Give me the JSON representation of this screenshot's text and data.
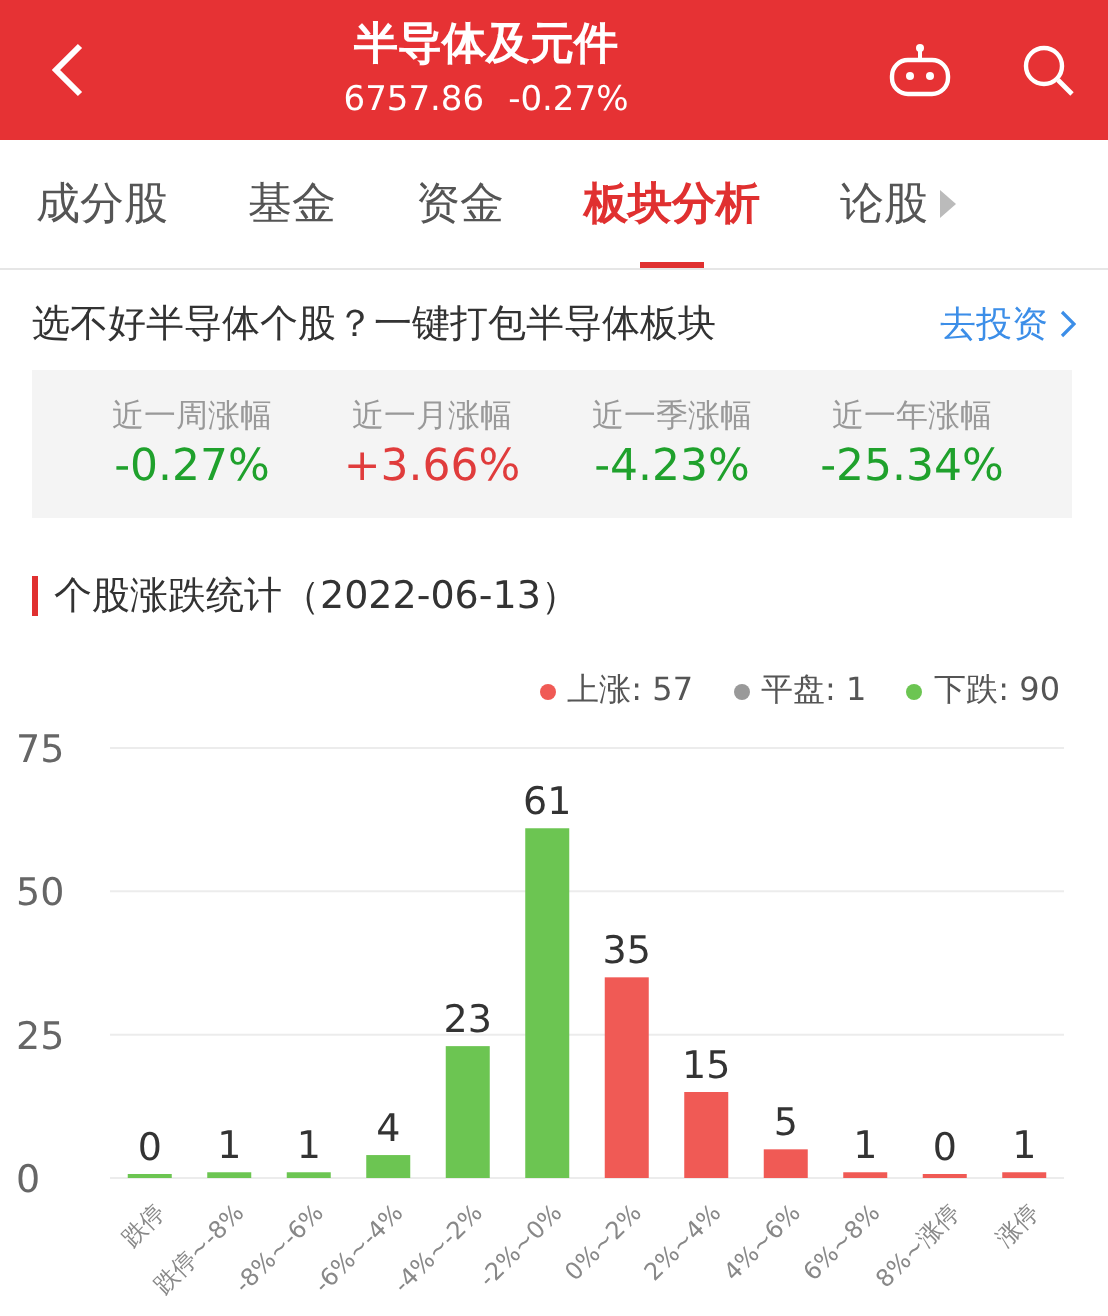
{
  "header": {
    "title": "半导体及元件",
    "price": "6757.86",
    "change": "-0.27%"
  },
  "tabs": [
    {
      "label": "成分股",
      "selected": false
    },
    {
      "label": "基金",
      "selected": false
    },
    {
      "label": "资金",
      "selected": false
    },
    {
      "label": "板块分析",
      "selected": true
    },
    {
      "label": "论股",
      "selected": false
    }
  ],
  "promo": {
    "text": "选不好半导体个股？一键打包半导体板块",
    "link": "去投资"
  },
  "stats": [
    {
      "label": "近一周涨幅",
      "value": "-0.27%",
      "color": "#1fa12c"
    },
    {
      "label": "近一月涨幅",
      "value": "+3.66%",
      "color": "#e03c3c"
    },
    {
      "label": "近一季涨幅",
      "value": "-4.23%",
      "color": "#1fa12c"
    },
    {
      "label": "近一年涨幅",
      "value": "-25.34%",
      "color": "#1fa12c"
    }
  ],
  "section": {
    "title": "个股涨跌统计（2022-06-13）"
  },
  "legend": [
    {
      "label": "上涨: 57",
      "color": "#f05a55"
    },
    {
      "label": "平盘: 1",
      "color": "#999999"
    },
    {
      "label": "下跌: 90",
      "color": "#6cc552"
    }
  ],
  "chart_data": {
    "type": "bar",
    "stacked": true,
    "data_labels": true,
    "categories": [
      "跌停",
      "跌停~-8%",
      "-8%~-6%",
      "-6%~-4%",
      "-4%~-2%",
      "-2%~0%",
      "0%~2%",
      "2%~4%",
      "4%~6%",
      "6%~8%",
      "8%~涨停",
      "涨停"
    ],
    "ylim": [
      0,
      75
    ],
    "yticks": [
      0,
      25,
      50,
      75
    ],
    "series": [
      {
        "color": "#6cc552",
        "values": [
          0,
          1,
          1,
          4,
          23,
          61,
          null,
          null,
          null,
          null,
          null,
          null
        ]
      },
      {
        "color": "#f05a55",
        "values": [
          null,
          null,
          null,
          null,
          null,
          null,
          35,
          15,
          5,
          1,
          0,
          1
        ]
      }
    ]
  }
}
